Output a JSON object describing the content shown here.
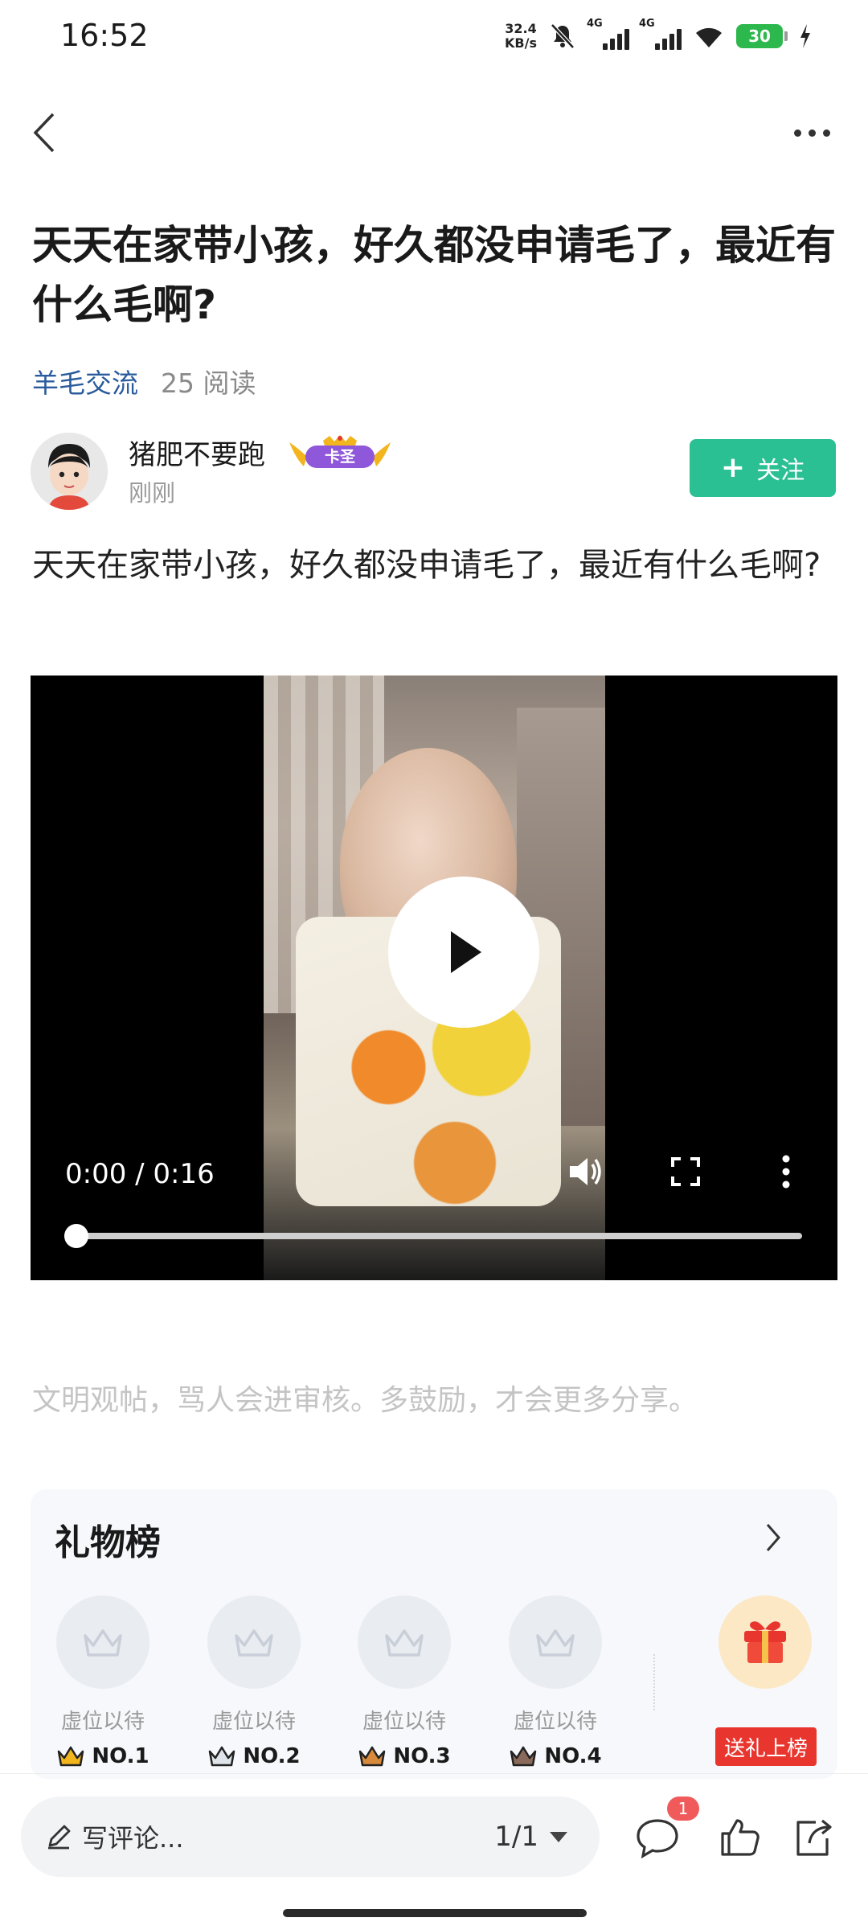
{
  "status_bar": {
    "time": "16:52",
    "net_speed_value": "32.4",
    "net_speed_unit": "KB/s",
    "signal1_tag": "4G",
    "signal2_tag": "4G",
    "battery": "30"
  },
  "post": {
    "title": "天天在家带小孩，好久都没申请毛了，最近有什么毛啊?",
    "channel": "羊毛交流",
    "reads": "25 阅读",
    "author": "猪肥不要跑",
    "badge_text": "卡圣",
    "time": "刚刚",
    "follow_label": "关注",
    "body": "天天在家带小孩，好久都没申请毛了，最近有什么毛啊?"
  },
  "video": {
    "time": "0:00 / 0:16",
    "progress": 0
  },
  "notice": "文明观帖，骂人会进审核。多鼓励，才会更多分享。",
  "gift": {
    "title": "礼物榜",
    "slots": [
      {
        "label": "虚位以待",
        "rank": "NO.1",
        "crown_color": "#f2b51d"
      },
      {
        "label": "虚位以待",
        "rank": "NO.2",
        "crown_color": "#5a6570"
      },
      {
        "label": "虚位以待",
        "rank": "NO.3",
        "crown_color": "#c9822d"
      },
      {
        "label": "虚位以待",
        "rank": "NO.4",
        "crown_color": "#6b4a3a"
      }
    ],
    "send_label": "送礼上榜"
  },
  "bottom_bar": {
    "comment_placeholder": "写评论...",
    "page_indicator": "1/1",
    "comment_count": "1"
  },
  "colors": {
    "accent": "#2bbf94",
    "link": "#2a5b9c",
    "badge_red": "#e8362f"
  }
}
